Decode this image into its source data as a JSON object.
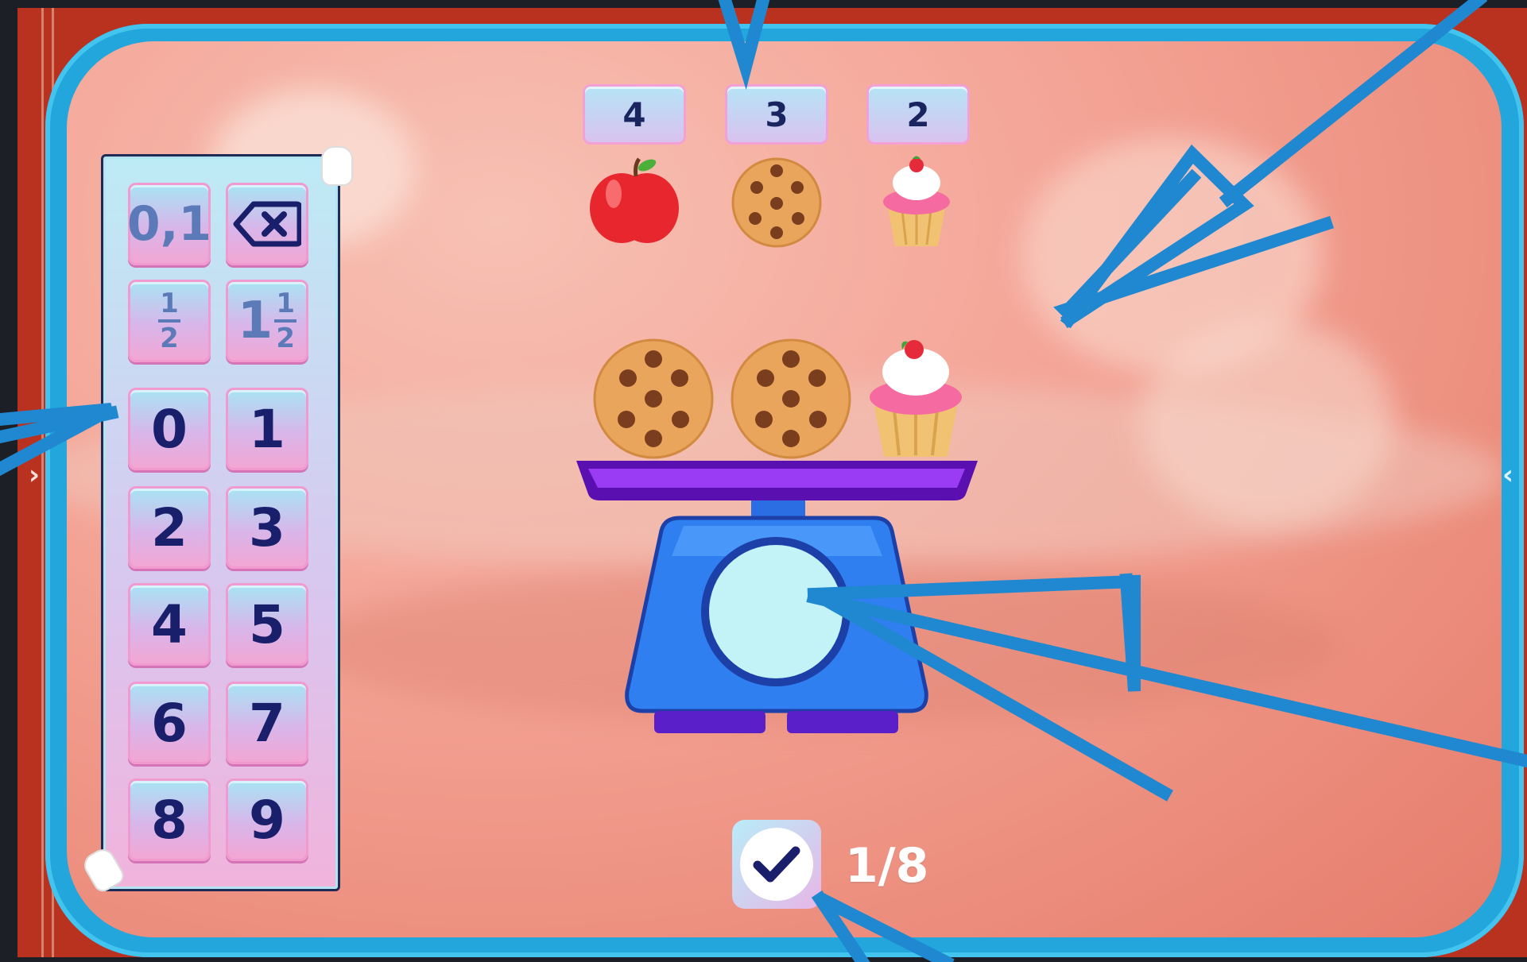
{
  "targets": [
    {
      "count": "4",
      "item": "apple"
    },
    {
      "count": "3",
      "item": "cookie"
    },
    {
      "count": "2",
      "item": "cupcake"
    }
  ],
  "keypad": {
    "decimal_label": "0,1",
    "backspace_icon": "backspace-icon",
    "half": {
      "num": "1",
      "den": "2"
    },
    "one_and_half": {
      "whole": "1",
      "num": "1",
      "den": "2"
    },
    "digits": [
      "0",
      "1",
      "2",
      "3",
      "4",
      "5",
      "6",
      "7",
      "8",
      "9"
    ]
  },
  "scale": {
    "items_on_pan": [
      "cookie",
      "cookie",
      "cupcake"
    ],
    "display_value": ""
  },
  "check_button": {
    "icon": "checkmark-icon"
  },
  "progress": "1/8",
  "colors": {
    "frame": "#22a6dc",
    "background": "#b8321f",
    "keypad_text": "#1a1f6b",
    "scale_body": "#2a6fe0",
    "scale_pan": "#7a1bd6",
    "annotation": "#1f88d0"
  }
}
